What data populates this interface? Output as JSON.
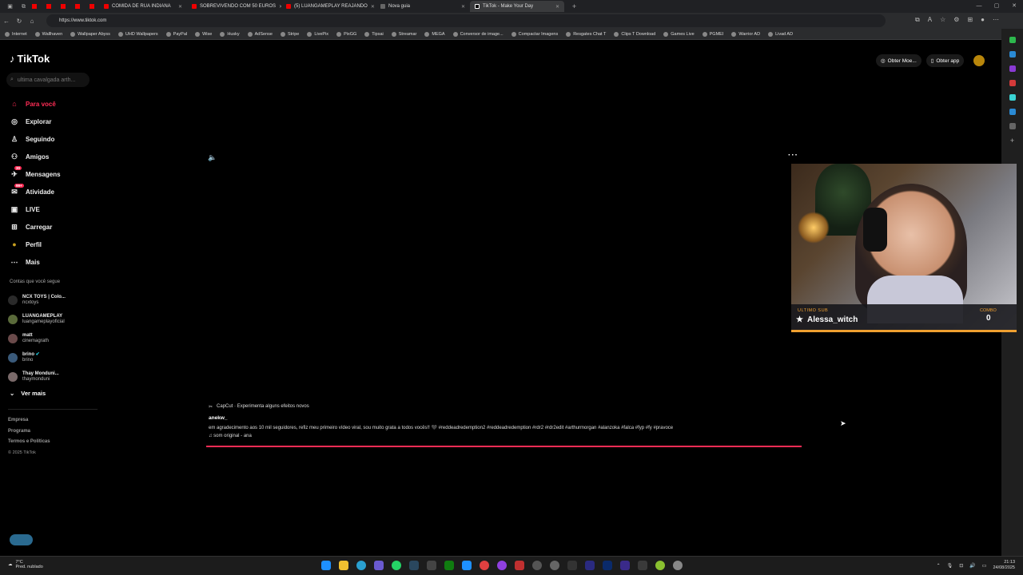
{
  "browser": {
    "tabs": [
      {
        "title": "",
        "type": "pinned"
      },
      {
        "title": "",
        "type": "pinned"
      },
      {
        "title": "",
        "type": "pinned"
      },
      {
        "title": "",
        "type": "pinned"
      },
      {
        "title": "",
        "type": "pinned"
      },
      {
        "title": "COMIDA DE RUA INDIANA",
        "type": "tab"
      },
      {
        "title": "SOBREVIVENDO COM 50 EUROS",
        "type": "tab"
      },
      {
        "title": "(5) LUANGAMEPLAY REAJANDO",
        "type": "tab"
      },
      {
        "title": "Nova guia",
        "type": "tab"
      },
      {
        "title": "TikTok - Make Your Day",
        "type": "active"
      }
    ],
    "url": "https://www.tiktok.com",
    "bookmarks": [
      "Internet",
      "Wallhaven",
      "Wallpaper Abyss",
      "UHD Wallpapers",
      "PayPal",
      "Wise",
      "Husky",
      "AdSense",
      "Stripe",
      "LivePix",
      "PixGG",
      "Tipsai",
      "Streamar",
      "MEGA",
      "Conversor de image...",
      "Compactar Imagens",
      "Resgates Chat T",
      "Clips T Download",
      "Games Live",
      "PGMEI",
      "Warrior AD",
      "Livad AD"
    ]
  },
  "sidebar": {
    "logo": "TikTok",
    "search_placeholder": "ultima cavalgada arth...",
    "nav": [
      {
        "label": "Para você",
        "icon": "home-icon",
        "active": true
      },
      {
        "label": "Explorar",
        "icon": "compass-icon"
      },
      {
        "label": "Seguindo",
        "icon": "following-icon"
      },
      {
        "label": "Amigos",
        "icon": "friends-icon"
      },
      {
        "label": "Mensagens",
        "icon": "messages-icon",
        "badge": "30"
      },
      {
        "label": "Atividade",
        "icon": "activity-icon",
        "badge": "99+"
      },
      {
        "label": "LIVE",
        "icon": "live-icon"
      },
      {
        "label": "Carregar",
        "icon": "upload-icon"
      },
      {
        "label": "Perfil",
        "icon": "profile-icon"
      },
      {
        "label": "Mais",
        "icon": "more-icon"
      }
    ],
    "following_title": "Contas que você segue",
    "following": [
      {
        "name": "NCX TOYS | Colo...",
        "user": "ncxtoys"
      },
      {
        "name": "LUANGAMEPLAY",
        "user": "luangameplayoficial"
      },
      {
        "name": "matt",
        "user": "cinemagrath"
      },
      {
        "name": "brino",
        "user": "brino"
      },
      {
        "name": "Thay Monduni...",
        "user": "thaymonduni"
      }
    ],
    "see_more": "Ver mais",
    "footer": [
      "Empresa",
      "Programa",
      "Termos e Políticas"
    ],
    "copyright": "© 2025 TikTok"
  },
  "header": {
    "coins_label": "Obter Moe...",
    "app_label": "Obter app"
  },
  "video": {
    "capcut": "CapCut · Experimenta alguns efeitos novos",
    "author": "anekw_",
    "description": "em agradecimento aos 10 mil seguidores, refiz meu primeiro vídeo viral, sou muito grata a todos vocês!! 🖤 #reddeadredemption2 #reddeadredemption #rdr2 #rdr2edit #arthurmorgan #alanzoka #falca #fyp #fy #pravoce",
    "music": "♫ som original - ana",
    "progress": 1.0
  },
  "stream_overlay": {
    "last_sub_label": "ULTIMO SUB",
    "last_sub_name": "Alessa_witch",
    "combo_label": "COMBO",
    "combo_value": "0"
  },
  "taskbar": {
    "weather_temp": "7°C",
    "weather_desc": "Pred. nublado",
    "time": "21:13",
    "date": "24/08/2025"
  },
  "colors": {
    "accent": "#fe2c55",
    "overlay_accent": "#f0a030"
  }
}
